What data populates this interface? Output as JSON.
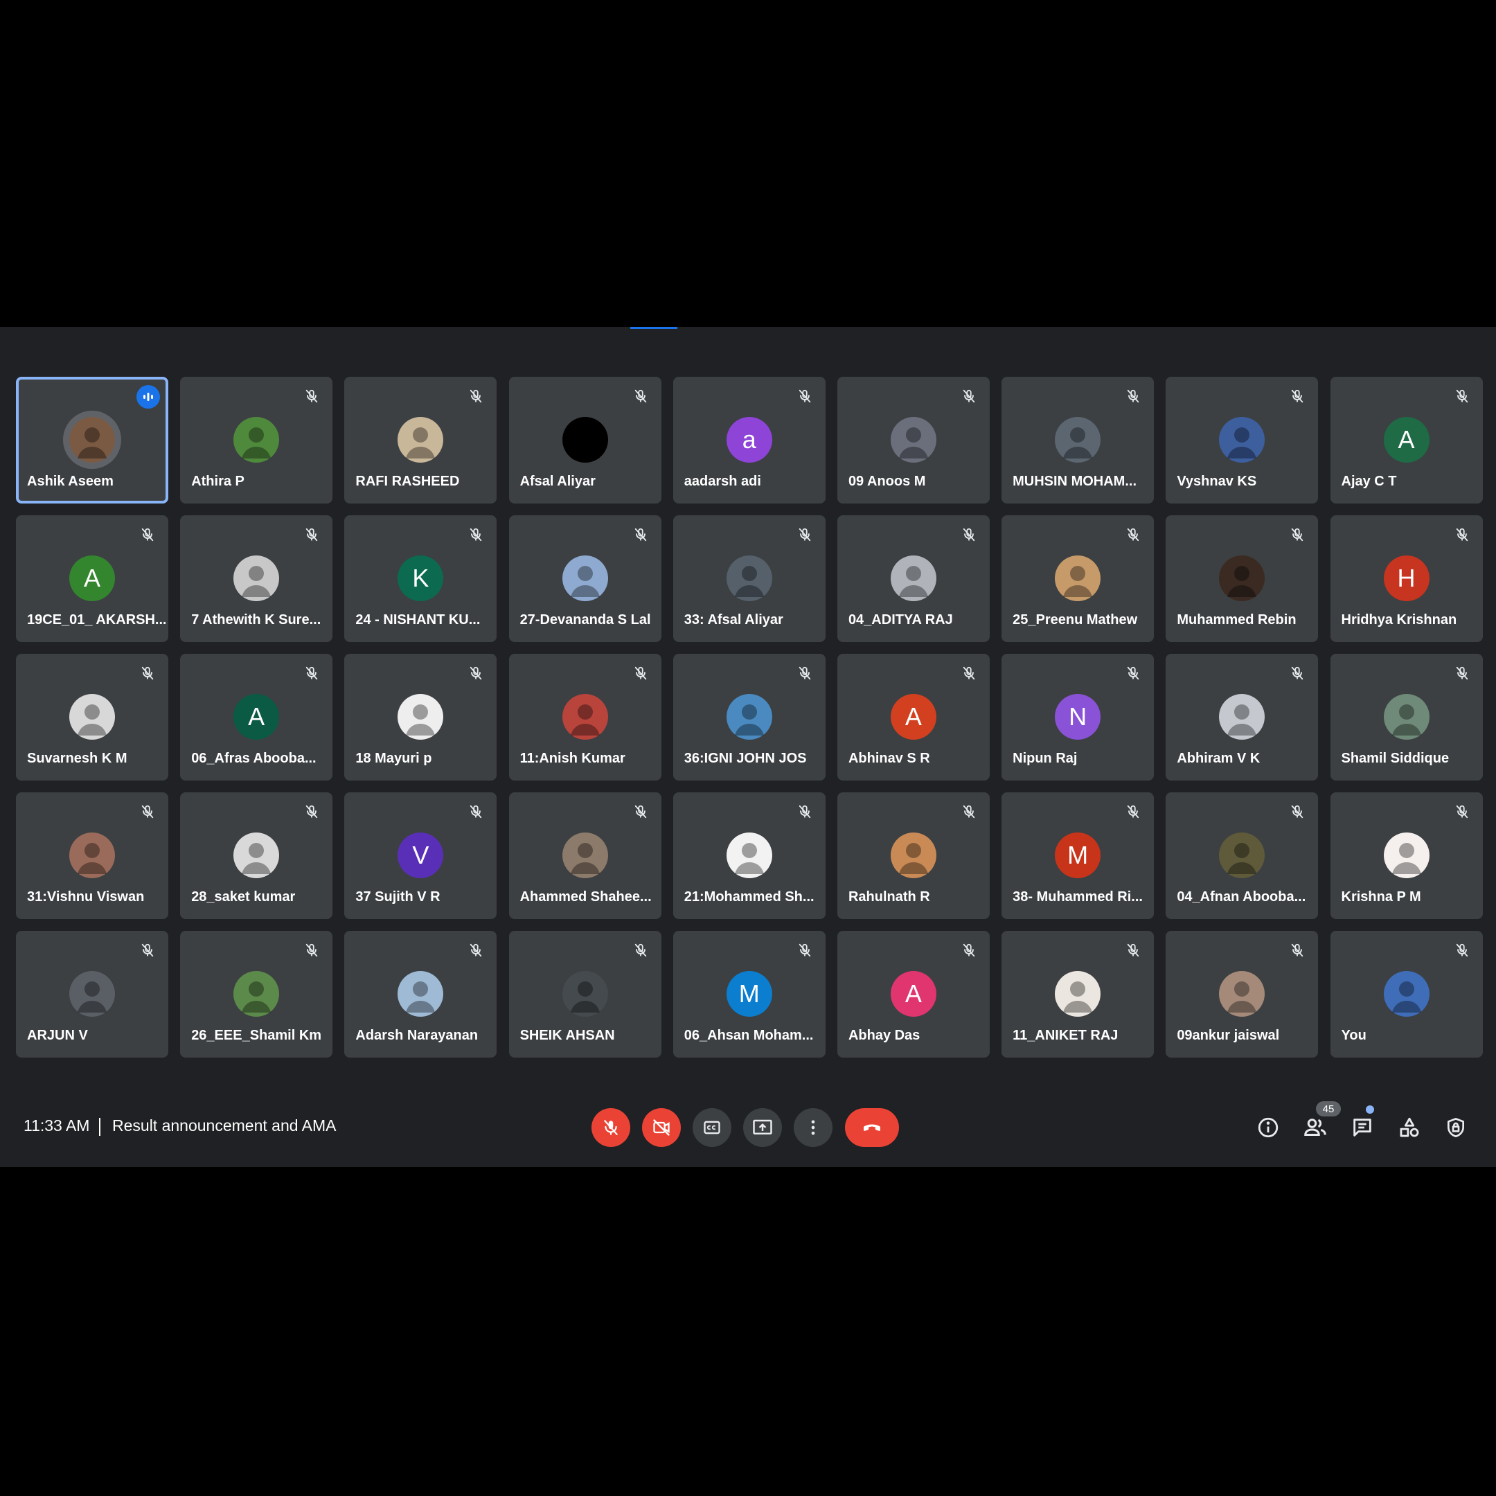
{
  "meeting": {
    "time": "11:33 AM",
    "title": "Result announcement and AMA",
    "participant_count": "45"
  },
  "colors": {
    "tile_bg": "#3c4043",
    "call_bg": "#202124",
    "accent": "#1a73e8",
    "danger": "#ea4335"
  },
  "participants": [
    {
      "name": "Ashik Aseem",
      "avatar": "photo",
      "color": "#7b5a44",
      "speaking": true
    },
    {
      "name": "Athira P",
      "avatar": "photo",
      "color": "#4f8a3c"
    },
    {
      "name": "RAFI RASHEED",
      "avatar": "photo",
      "color": "#c9b79a"
    },
    {
      "name": "Afsal Aliyar",
      "avatar": "photo",
      "color": "#000000"
    },
    {
      "name": "aadarsh adi",
      "avatar": "initial",
      "initial": "a",
      "color": "#8e44d6"
    },
    {
      "name": "09 Anoos M",
      "avatar": "photo",
      "color": "#6a6f7b"
    },
    {
      "name": "MUHSIN MOHAM...",
      "avatar": "photo",
      "color": "#5b6670"
    },
    {
      "name": "Vyshnav KS",
      "avatar": "photo",
      "color": "#3d5f9e"
    },
    {
      "name": "Ajay C T",
      "avatar": "initial",
      "initial": "A",
      "color": "#1e6b45"
    },
    {
      "name": "19CE_01_ AKARSH...",
      "avatar": "initial",
      "initial": "A",
      "color": "#33862e"
    },
    {
      "name": "7 Athewith K Sure...",
      "avatar": "photo",
      "color": "#c8c8c8"
    },
    {
      "name": "24 - NISHANT KU...",
      "avatar": "initial",
      "initial": "K",
      "color": "#0b6a4f"
    },
    {
      "name": "27-Devananda S Lal",
      "avatar": "photo",
      "color": "#8faad0"
    },
    {
      "name": "33: Afsal Aliyar",
      "avatar": "photo",
      "color": "#55606a"
    },
    {
      "name": "04_ADITYA RAJ",
      "avatar": "photo",
      "color": "#b0b4ba"
    },
    {
      "name": "25_Preenu Mathew",
      "avatar": "photo",
      "color": "#c79a6a"
    },
    {
      "name": "Muhammed Rebin",
      "avatar": "photo",
      "color": "#3a2a22"
    },
    {
      "name": "Hridhya Krishnan",
      "avatar": "initial",
      "initial": "H",
      "color": "#c7341f"
    },
    {
      "name": "Suvarnesh K M",
      "avatar": "photo",
      "color": "#d8d8d8"
    },
    {
      "name": "06_Afras Abooba...",
      "avatar": "initial",
      "initial": "A",
      "color": "#0b5a44"
    },
    {
      "name": "18 Mayuri p",
      "avatar": "photo",
      "color": "#eeeeee"
    },
    {
      "name": "11:Anish Kumar",
      "avatar": "photo",
      "color": "#b8443c"
    },
    {
      "name": "36:IGNI JOHN JOS",
      "avatar": "photo",
      "color": "#4a8ac0"
    },
    {
      "name": "Abhinav S R",
      "avatar": "initial",
      "initial": "A",
      "color": "#d2401f"
    },
    {
      "name": "Nipun Raj",
      "avatar": "initial",
      "initial": "N",
      "color": "#8a52d6"
    },
    {
      "name": "Abhiram V K",
      "avatar": "photo",
      "color": "#c5c9cf"
    },
    {
      "name": "Shamil Siddique",
      "avatar": "photo",
      "color": "#6f8a78"
    },
    {
      "name": "31:Vishnu Viswan",
      "avatar": "photo",
      "color": "#9a6b5a"
    },
    {
      "name": "28_saket kumar",
      "avatar": "photo",
      "color": "#d9d9d9"
    },
    {
      "name": "37 Sujith V R",
      "avatar": "initial",
      "initial": "V",
      "color": "#5a2fb8"
    },
    {
      "name": "Ahammed Shahee...",
      "avatar": "photo",
      "color": "#8c7a6a"
    },
    {
      "name": "21:Mohammed Sh...",
      "avatar": "photo",
      "color": "#f2f2f2"
    },
    {
      "name": "Rahulnath R",
      "avatar": "photo",
      "color": "#c98a55"
    },
    {
      "name": "38- Muhammed Ri...",
      "avatar": "initial",
      "initial": "M",
      "color": "#c8341a"
    },
    {
      "name": "04_Afnan Abooba...",
      "avatar": "photo",
      "color": "#5e5a3a"
    },
    {
      "name": "Krishna P M",
      "avatar": "photo",
      "color": "#f5f0ee"
    },
    {
      "name": "ARJUN V",
      "avatar": "photo",
      "color": "#5a5f66"
    },
    {
      "name": "26_EEE_Shamil Km",
      "avatar": "photo",
      "color": "#5c8a4a"
    },
    {
      "name": "Adarsh Narayanan",
      "avatar": "photo",
      "color": "#9fbad4"
    },
    {
      "name": "SHEIK AHSAN",
      "avatar": "photo",
      "color": "#444a4e"
    },
    {
      "name": "06_Ahsan Moham...",
      "avatar": "initial",
      "initial": "M",
      "color": "#0b7ecf"
    },
    {
      "name": "Abhay Das",
      "avatar": "initial",
      "initial": "A",
      "color": "#e0356e"
    },
    {
      "name": "11_ANIKET RAJ",
      "avatar": "photo",
      "color": "#ece6e0"
    },
    {
      "name": "09ankur jaiswal",
      "avatar": "photo",
      "color": "#a58a7a"
    },
    {
      "name": "You",
      "avatar": "photo",
      "color": "#3f6db8"
    }
  ],
  "controls": {
    "mic": "mic-off-icon",
    "camera": "camera-off-icon",
    "captions": "closed-captions-icon",
    "present": "present-screen-icon",
    "more": "more-options-icon",
    "leave": "end-call-icon"
  },
  "right_icons": [
    "info-icon",
    "people-icon",
    "chat-icon",
    "activities-icon",
    "host-controls-icon"
  ]
}
